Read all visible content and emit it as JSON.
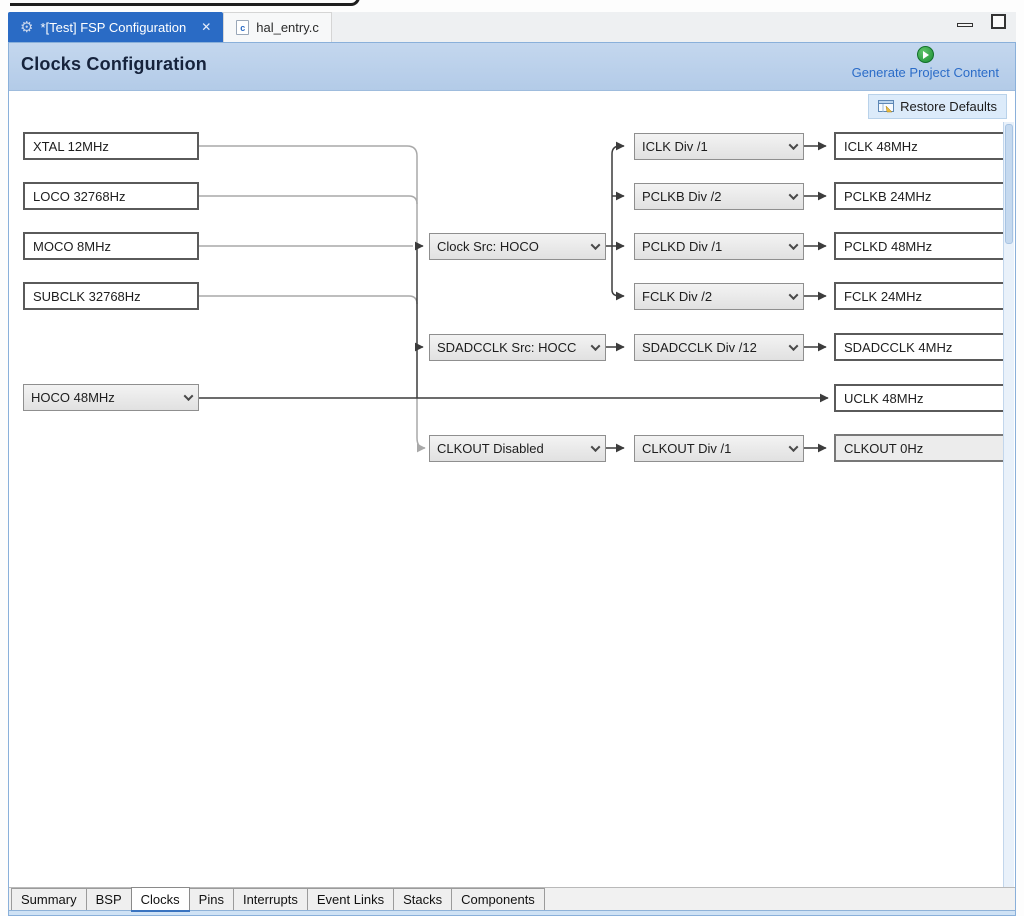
{
  "window": {
    "minimize": "minimize",
    "maximize": "maximize"
  },
  "editor_tabs": [
    {
      "label": "*[Test] FSP Configuration",
      "icon": "gear",
      "active": true,
      "closable": true
    },
    {
      "label": "hal_entry.c",
      "icon": "c-file",
      "icon_letter": "c",
      "active": false
    }
  ],
  "header": {
    "title": "Clocks Configuration",
    "generate_label": "Generate Project Content"
  },
  "toolbar": {
    "restore_defaults_label": "Restore Defaults"
  },
  "diagram": {
    "sources": [
      {
        "label": "XTAL 12MHz",
        "kind": "box"
      },
      {
        "label": "LOCO 32768Hz",
        "kind": "box"
      },
      {
        "label": "MOCO 8MHz",
        "kind": "box"
      },
      {
        "label": "SUBCLK 32768Hz",
        "kind": "box"
      },
      {
        "label": "HOCO 48MHz",
        "kind": "dropdown"
      }
    ],
    "selectors": [
      {
        "label": "Clock Src: HOCO"
      },
      {
        "label": "SDADCCLK Src: HOCC"
      },
      {
        "label": "CLKOUT Disabled"
      }
    ],
    "dividers": [
      {
        "label": "ICLK Div /1"
      },
      {
        "label": "PCLKB Div /2"
      },
      {
        "label": "PCLKD Div /1"
      },
      {
        "label": "FCLK Div /2"
      },
      {
        "label": "SDADCCLK Div /12"
      },
      {
        "label": "CLKOUT Div /1"
      }
    ],
    "outputs": [
      {
        "label": "ICLK 48MHz"
      },
      {
        "label": "PCLKB 24MHz"
      },
      {
        "label": "PCLKD 48MHz"
      },
      {
        "label": "FCLK 24MHz"
      },
      {
        "label": "SDADCCLK 4MHz"
      },
      {
        "label": "UCLK 48MHz"
      },
      {
        "label": "CLKOUT 0Hz",
        "disabled": true
      }
    ]
  },
  "bottom_tabs": [
    {
      "label": "Summary"
    },
    {
      "label": "BSP"
    },
    {
      "label": "Clocks",
      "active": true
    },
    {
      "label": "Pins"
    },
    {
      "label": "Interrupts"
    },
    {
      "label": "Event Links"
    },
    {
      "label": "Stacks"
    },
    {
      "label": "Components"
    }
  ],
  "colors": {
    "active_tab_blue": "#2a6bc5",
    "header_band_blue": "#b9cfe9",
    "link_blue": "#2b6cc8",
    "play_green": "#1d8f33",
    "wire_inactive": "#a9a9a9",
    "wire_active": "#3c3c3c",
    "frame_border": "#8ab0da",
    "bottom_strip": "#cfe2f5"
  }
}
